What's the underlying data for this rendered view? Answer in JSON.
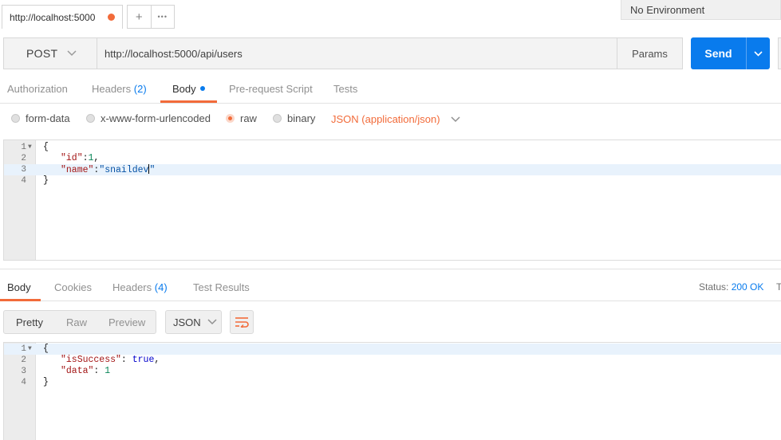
{
  "tabs": {
    "active_title": "http://localhost:5000",
    "new_tab_symbol": "+",
    "more_symbol": "•••"
  },
  "environment": {
    "label": "No Environment"
  },
  "request": {
    "method": "POST",
    "url": "http://localhost:5000/api/users",
    "params_label": "Params",
    "send_label": "Send"
  },
  "request_tabs": [
    {
      "label": "Authorization"
    },
    {
      "label": "Headers",
      "count": "(2)"
    },
    {
      "label": "Body"
    },
    {
      "label": "Pre-request Script"
    },
    {
      "label": "Tests"
    }
  ],
  "body_types": {
    "form_data": "form-data",
    "urlencoded": "x-www-form-urlencoded",
    "raw": "raw",
    "binary": "binary",
    "content_type": "JSON (application/json)"
  },
  "request_body": {
    "line_numbers": [
      "1",
      "2",
      "3",
      "4"
    ],
    "line1": "{",
    "line2_key": "\"id\"",
    "line2_sep": ":",
    "line2_val": "1",
    "line2_end": ",",
    "line3_key": "\"name\"",
    "line3_sep": ":",
    "line3_val_a": "\"snaildev",
    "line3_val_b": "\"",
    "line4": "}"
  },
  "response_tabs": [
    {
      "label": "Body"
    },
    {
      "label": "Cookies"
    },
    {
      "label": "Headers",
      "count": "(4)"
    },
    {
      "label": "Test Results"
    }
  ],
  "status": {
    "label": "Status:",
    "value": "200 OK",
    "next": "T"
  },
  "response_view": {
    "pretty": "Pretty",
    "raw": "Raw",
    "preview": "Preview",
    "format": "JSON"
  },
  "response_body": {
    "line_numbers": [
      "1",
      "2",
      "3",
      "4"
    ],
    "line1": "{",
    "line2_key": "\"isSuccess\"",
    "line2_sep": ": ",
    "line2_val": "true",
    "line2_end": ",",
    "line3_key": "\"data\"",
    "line3_sep": ": ",
    "line3_val": "1",
    "line4": "}"
  },
  "colors": {
    "accent_orange": "#f26b3a",
    "accent_blue": "#097bed"
  }
}
